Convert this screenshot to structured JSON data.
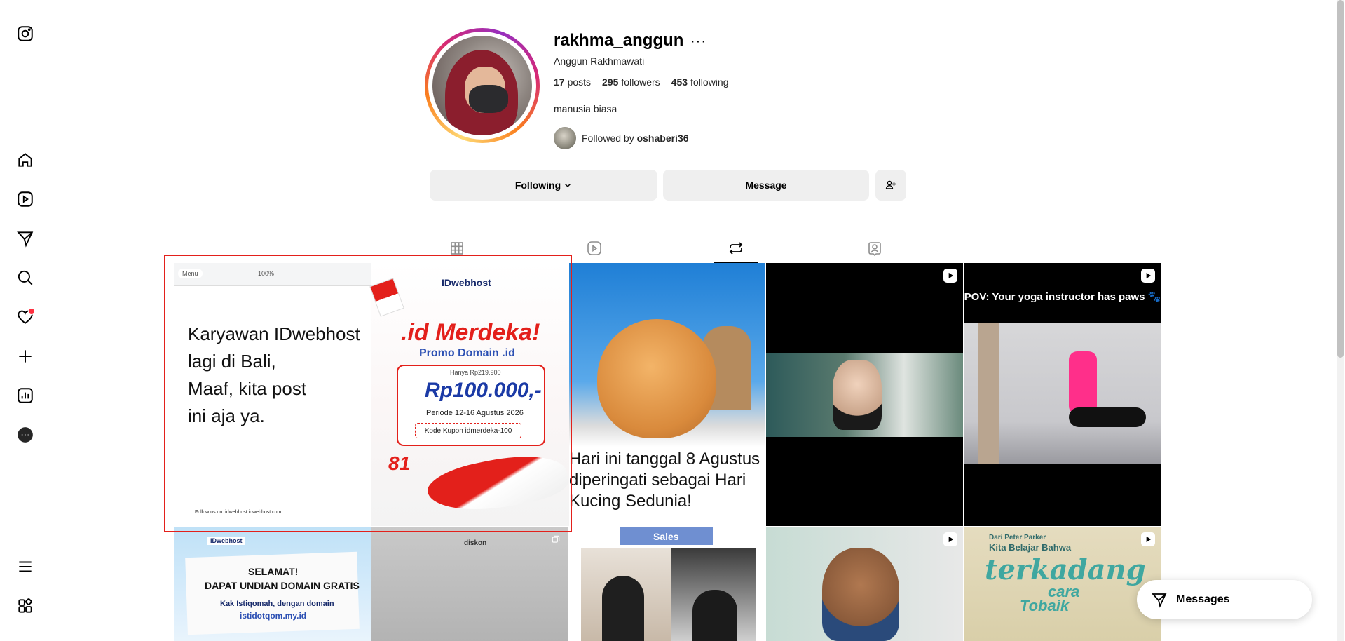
{
  "profile": {
    "username": "rakhma_anggun",
    "more_label": "···",
    "full_name": "Anggun Rakhmawati",
    "posts_count": "17",
    "posts_label": "posts",
    "followers_count": "295",
    "followers_label": "followers",
    "following_count": "453",
    "following_label": "following",
    "bio": "manusia biasa",
    "followed_by_prefix": "Followed by",
    "followed_by_user": "oshaberi36"
  },
  "actions": {
    "following_label": "Following",
    "message_label": "Message"
  },
  "nav": {
    "icons": [
      "instagram-logo-icon",
      "home-icon",
      "reels-icon",
      "send-icon",
      "search-icon",
      "heart-icon",
      "create-icon",
      "dashboard-icon",
      "profile-icon",
      "menu-icon",
      "also-from-meta-icon"
    ]
  },
  "tabs": [
    "posts-grid",
    "reels",
    "reposts",
    "tagged"
  ],
  "posts": {
    "tile1": {
      "toolbar_menu": "Menu",
      "toolbar_zoom": "100%",
      "text_lines": [
        "Karyawan IDwebhost",
        "lagi di Bali,",
        "Maaf, kita post",
        "ini aja ya."
      ],
      "footer": "Follow us on:  idwebhost   idwebhost.com",
      "brand": "IDwebhost",
      "headline": ".id Merdeka!",
      "promo": "Promo Domain .id",
      "hanya": "Hanya Rp219.900",
      "price": "Rp100.000,-",
      "periode": "Periode 12-16 Agustus 2026",
      "kode": "Kode Kupon  idmerdeka-100",
      "eighty": "81"
    },
    "tile2": {
      "caption": "Hari ini tanggal 8 Agustus diperingati sebagai Hari Kucing Sedunia!"
    },
    "tile4": {
      "caption": "POV: Your yoga instructor has paws 🐾"
    },
    "tile5": {
      "brand": "IDwebhost",
      "line1": "SELAMAT!",
      "line2": "DAPAT UNDIAN DOMAIN GRATIS",
      "line3": "Kak Istiqomah, dengan domain",
      "line4": "istidotqom.my.id"
    },
    "tile6": {
      "brand": "diskon"
    },
    "tile7": {
      "banner": "Sales"
    },
    "tile9": {
      "line1": "Dari Peter Parker",
      "line2": "Kita Belajar Bahwa",
      "line3": "terkadang",
      "line4": "cara",
      "line5": "Tobaik"
    }
  },
  "messages": {
    "label": "Messages"
  },
  "colors": {
    "accent": "#e3201b",
    "button_bg": "#efefef",
    "brand_blue": "#1b3aa6"
  }
}
